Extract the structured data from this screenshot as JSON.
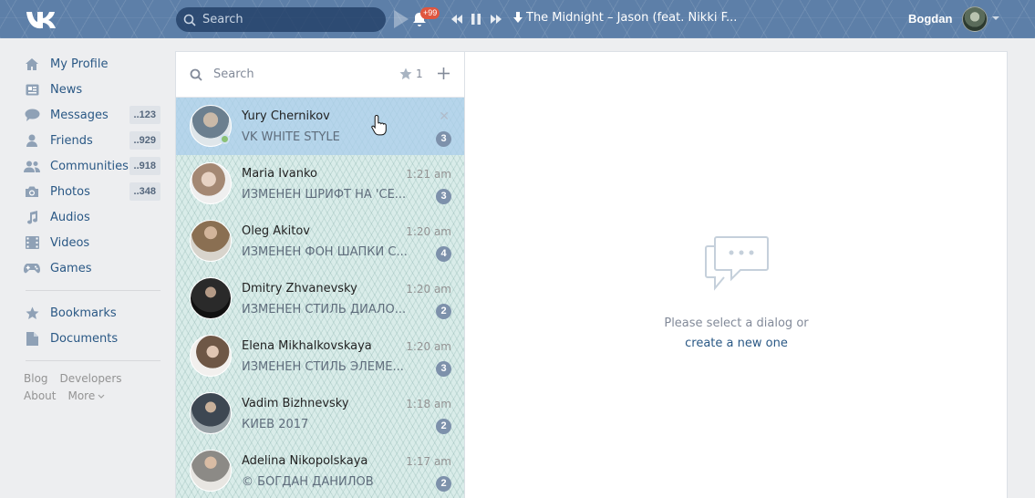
{
  "header": {
    "search_placeholder": "Search",
    "notification_badge": "+99",
    "track": "The Midnight – Jason (feat. Nikki F...",
    "user_name": "Bogdan"
  },
  "sidebar": {
    "items": [
      {
        "label": "My Profile",
        "icon": "home-icon",
        "count": ""
      },
      {
        "label": "News",
        "icon": "news-icon",
        "count": ""
      },
      {
        "label": "Messages",
        "icon": "messages-icon",
        "count": "..123"
      },
      {
        "label": "Friends",
        "icon": "friends-icon",
        "count": "..929"
      },
      {
        "label": "Communities",
        "icon": "communities-icon",
        "count": "..918"
      },
      {
        "label": "Photos",
        "icon": "camera-icon",
        "count": "..348"
      },
      {
        "label": "Audios",
        "icon": "music-note-icon",
        "count": ""
      },
      {
        "label": "Videos",
        "icon": "film-icon",
        "count": ""
      },
      {
        "label": "Games",
        "icon": "gamepad-icon",
        "count": ""
      }
    ],
    "secondary": [
      {
        "label": "Bookmarks",
        "icon": "star-icon"
      },
      {
        "label": "Documents",
        "icon": "document-icon"
      }
    ],
    "footer": {
      "blog": "Blog",
      "developers": "Developers",
      "about": "About",
      "more": "More"
    }
  },
  "dialogs": {
    "search_placeholder": "Search",
    "starred_count": "1",
    "items": [
      {
        "name": "Yury Chernikov",
        "time": "",
        "message": "VK WHITE STYLE",
        "unread": "3"
      },
      {
        "name": "Maria Ivanko",
        "time": "1:21 am",
        "message": "ИЗМЕНЕН ШРИФТ НА 'СЕ...",
        "unread": "3"
      },
      {
        "name": "Oleg Akitov",
        "time": "1:20 am",
        "message": "ИЗМЕНЕН ФОН ШАПКИ С...",
        "unread": "4"
      },
      {
        "name": "Dmitry Zhvanevsky",
        "time": "1:20 am",
        "message": "ИЗМЕНЕН СТИЛЬ ДИАЛО...",
        "unread": "2"
      },
      {
        "name": "Elena Mikhalkovskaya",
        "time": "1:20 am",
        "message": "ИЗМЕНЕН СТИЛЬ ЭЛЕМЕ...",
        "unread": "3"
      },
      {
        "name": "Vadim Bizhnevsky",
        "time": "1:18 am",
        "message": "КИЕВ 2017",
        "unread": "2"
      },
      {
        "name": "Adelina Nikopolskaya",
        "time": "1:17 am",
        "message": "© БОГДАН ДАНИЛОВ",
        "unread": "2"
      }
    ]
  },
  "main": {
    "empty_line1": "Please select a dialog or",
    "empty_link": "create a new one"
  },
  "colors": {
    "header": "#5d7fa8",
    "link": "#2a5885",
    "unread_badge": "#7d91ab",
    "online": "#8ac176"
  }
}
